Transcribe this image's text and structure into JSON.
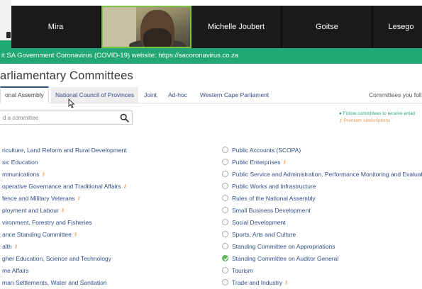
{
  "zoom": {
    "participants": [
      {
        "name": "Mira",
        "video": false,
        "width": 127
      },
      {
        "name": "",
        "video": true,
        "width": 127
      },
      {
        "name": "Michelle Joubert",
        "video": false,
        "width": 128
      },
      {
        "name": "Goitse",
        "video": false,
        "width": 128
      },
      {
        "name": "Lesego",
        "video": false,
        "width": 69
      }
    ]
  },
  "banner": {
    "text": "it SA Government Coronavirus (COVID-19) website: https://sacoronavirus.co.za"
  },
  "page": {
    "title": "arliamentary Committees"
  },
  "tabs": [
    {
      "label": "onal Assembly",
      "state": "active"
    },
    {
      "label": "National Council of Provinces",
      "state": "hover"
    },
    {
      "label": "Joint",
      "state": "link"
    },
    {
      "label": "Ad-hoc",
      "state": "link"
    },
    {
      "label": "Western Cape Parliament",
      "state": "link"
    },
    {
      "label": "Committees you follo",
      "state": "right"
    }
  ],
  "search": {
    "placeholder": "d a committee"
  },
  "follow_note": {
    "follow": "Follow committees to receive email",
    "premium": "Premium subscriptions"
  },
  "committees_left": [
    {
      "label": "riculture, Land Reform and Rural Development",
      "premium": false
    },
    {
      "label": "sic Education",
      "premium": false
    },
    {
      "label": "mmunications",
      "premium": true
    },
    {
      "label": "operative Governance and Traditional Affairs",
      "premium": true
    },
    {
      "label": "fence and Military Veterans",
      "premium": true
    },
    {
      "label": "ployment and Labour",
      "premium": true
    },
    {
      "label": "vironment, Forestry and Fisheries",
      "premium": false
    },
    {
      "label": "ance Standing Committee",
      "premium": true
    },
    {
      "label": "alth",
      "premium": true
    },
    {
      "label": "gher Education, Science and Technology",
      "premium": false
    },
    {
      "label": "me Affairs",
      "premium": false
    },
    {
      "label": "man Settlements, Water and Sanitation",
      "premium": false
    }
  ],
  "committees_right": [
    {
      "label": "Public Accounts (SCOPA)",
      "premium": false,
      "checked": false
    },
    {
      "label": "Public Enterprises",
      "premium": true,
      "checked": false
    },
    {
      "label": "Public Service and Administration, Performance Monitoring and Evaluation",
      "premium": false,
      "checked": false
    },
    {
      "label": "Public Works and Infrastructure",
      "premium": false,
      "checked": false
    },
    {
      "label": "Rules of the National Assembly",
      "premium": false,
      "checked": false
    },
    {
      "label": "Small Business Development",
      "premium": false,
      "checked": false
    },
    {
      "label": "Social Development",
      "premium": false,
      "checked": false
    },
    {
      "label": "Sports, Arts and Culture",
      "premium": false,
      "checked": false
    },
    {
      "label": "Standing Committee on Appropriations",
      "premium": false,
      "checked": false
    },
    {
      "label": "Standing Committee on Auditor General",
      "premium": false,
      "checked": true
    },
    {
      "label": "Tourism",
      "premium": false,
      "checked": false
    },
    {
      "label": "Trade and Industry",
      "premium": true,
      "checked": false
    }
  ],
  "colors": {
    "brand_green": "#22a876",
    "link_blue": "#2f4e84",
    "premium_orange": "#e8954d",
    "zoom_bg": "#1a1a1a",
    "active_speaker": "#7cc241"
  }
}
